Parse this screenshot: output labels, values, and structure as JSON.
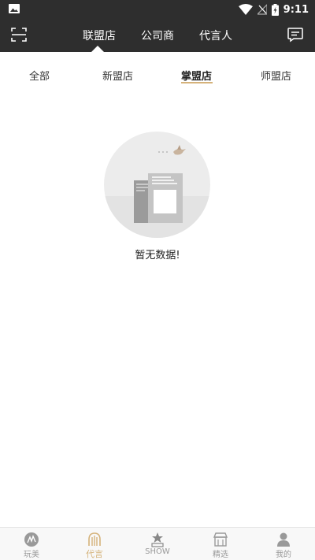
{
  "status_bar": {
    "time": "9:11",
    "icons": [
      "gallery-icon",
      "wifi-icon",
      "no-signal-icon",
      "battery-charging-icon"
    ]
  },
  "header": {
    "tabs": [
      {
        "label": "联盟店",
        "active": true
      },
      {
        "label": "公司商",
        "active": false
      },
      {
        "label": "代言人",
        "active": false
      }
    ],
    "left_icon": "scan-icon",
    "right_icon": "message-icon"
  },
  "sub_tabs": [
    {
      "label": "全部",
      "active": false
    },
    {
      "label": "新盟店",
      "active": false
    },
    {
      "label": "掌盟店",
      "active": true
    },
    {
      "label": "师盟店",
      "active": false
    }
  ],
  "empty_state": {
    "text": "暂无数据!"
  },
  "bottom_nav": [
    {
      "label": "玩美",
      "icon": "play-beauty-icon",
      "active": false
    },
    {
      "label": "代言",
      "icon": "endorse-icon",
      "active": true
    },
    {
      "label": "SHOW",
      "icon": "show-icon",
      "active": false
    },
    {
      "label": "精选",
      "icon": "store-icon",
      "active": false
    },
    {
      "label": "我的",
      "icon": "profile-icon",
      "active": false
    }
  ],
  "colors": {
    "header_bg": "#2e2e2e",
    "accent": "#d5b27a",
    "nav_inactive": "#999999"
  }
}
